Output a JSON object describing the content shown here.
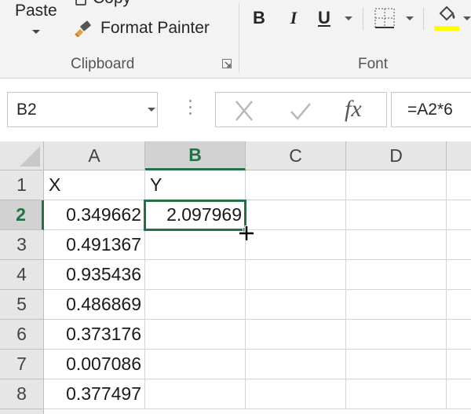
{
  "ribbon": {
    "clipboard": {
      "paste_label": "Paste",
      "copy_label": "Copy",
      "format_painter_label": "Format Painter",
      "group_label": "Clipboard"
    },
    "font": {
      "bold": "B",
      "italic": "I",
      "underline": "U",
      "group_label": "Font",
      "fill_color": "#ffff00"
    }
  },
  "formula_bar": {
    "name_box": "B2",
    "fx": "fx",
    "formula": "=A2*6"
  },
  "grid": {
    "columns": [
      "A",
      "B",
      "C",
      "D"
    ],
    "active_column": "B",
    "rows": [
      "1",
      "2",
      "3",
      "4",
      "5",
      "6",
      "7",
      "8"
    ],
    "active_row": "2",
    "cells": [
      {
        "row": "1",
        "A": "X",
        "B": "Y"
      },
      {
        "row": "2",
        "A": "0.349662",
        "B": "2.097969"
      },
      {
        "row": "3",
        "A": "0.491367",
        "B": ""
      },
      {
        "row": "4",
        "A": "0.935436",
        "B": ""
      },
      {
        "row": "5",
        "A": "0.486869",
        "B": ""
      },
      {
        "row": "6",
        "A": "0.373176",
        "B": ""
      },
      {
        "row": "7",
        "A": "0.007086",
        "B": ""
      },
      {
        "row": "8",
        "A": "0.377497",
        "B": ""
      }
    ],
    "selected_cell": "B2",
    "accent_color": "#217346"
  }
}
